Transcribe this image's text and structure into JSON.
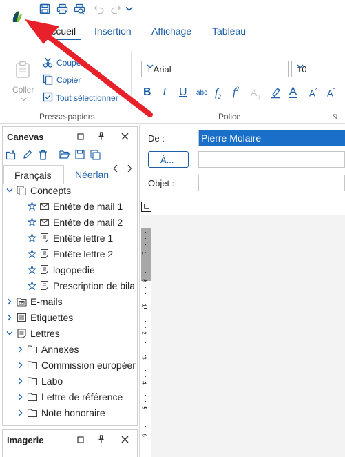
{
  "qat": {
    "icons": [
      "app-logo-icon",
      "save-icon",
      "print-icon",
      "print-preview-icon",
      "undo-icon",
      "redo-icon",
      "customize-icon"
    ]
  },
  "tabs": [
    {
      "label": "Accueil",
      "active": true
    },
    {
      "label": "Insertion"
    },
    {
      "label": "Affichage"
    },
    {
      "label": "Tableau"
    }
  ],
  "clipboard": {
    "paste": "Coller",
    "cut": "Couper",
    "copy": "Copier",
    "select_all": "Tout sélectionner",
    "group": "Presse-papiers"
  },
  "font": {
    "family": "Arial",
    "size": "10",
    "group": "Police"
  },
  "canevas": {
    "title": "Canevas",
    "lang_tabs": [
      "Français",
      "Néerlan"
    ],
    "tree": [
      {
        "label": "Concepts",
        "level": 0,
        "icon": "templates-icon",
        "expanded": true
      },
      {
        "label": "Entête de mail 1",
        "level": 2,
        "icon": "mail-icon"
      },
      {
        "label": "Entête de mail 2",
        "level": 2,
        "icon": "mail-icon"
      },
      {
        "label": "Entête lettre 1",
        "level": 2,
        "icon": "doc-icon"
      },
      {
        "label": "Entête lettre 2",
        "level": 2,
        "icon": "doc-icon"
      },
      {
        "label": "logopedie",
        "level": 2,
        "icon": "doc-icon"
      },
      {
        "label": "Prescription de bila",
        "level": 2,
        "icon": "doc-icon"
      },
      {
        "label": "E-mails",
        "level": 0,
        "icon": "mail-folder-icon"
      },
      {
        "label": "Etiquettes",
        "level": 0,
        "icon": "label-icon"
      },
      {
        "label": "Lettres",
        "level": 0,
        "icon": "letters-icon",
        "expanded": true
      },
      {
        "label": "Annexes",
        "level": 1,
        "icon": "folder-icon"
      },
      {
        "label": "Commission européer",
        "level": 1,
        "icon": "folder-icon"
      },
      {
        "label": "Labo",
        "level": 1,
        "icon": "folder-icon"
      },
      {
        "label": "Lettre de référence",
        "level": 1,
        "icon": "folder-icon"
      },
      {
        "label": "Note honoraire",
        "level": 1,
        "icon": "folder-icon"
      }
    ]
  },
  "imagerie": {
    "title": "Imagerie"
  },
  "mail": {
    "from_label": "De :",
    "from_value": "Pierre Molaire",
    "to_button": "À...",
    "subject_label": "Objet :"
  },
  "ruler": {
    "ticks": [
      "1",
      "0",
      "1",
      "2",
      "3",
      "4",
      "5",
      "6"
    ]
  },
  "colors": {
    "accent": "#1c5fa8",
    "selection": "#1a6fc9",
    "arrow": "#e8202a"
  }
}
